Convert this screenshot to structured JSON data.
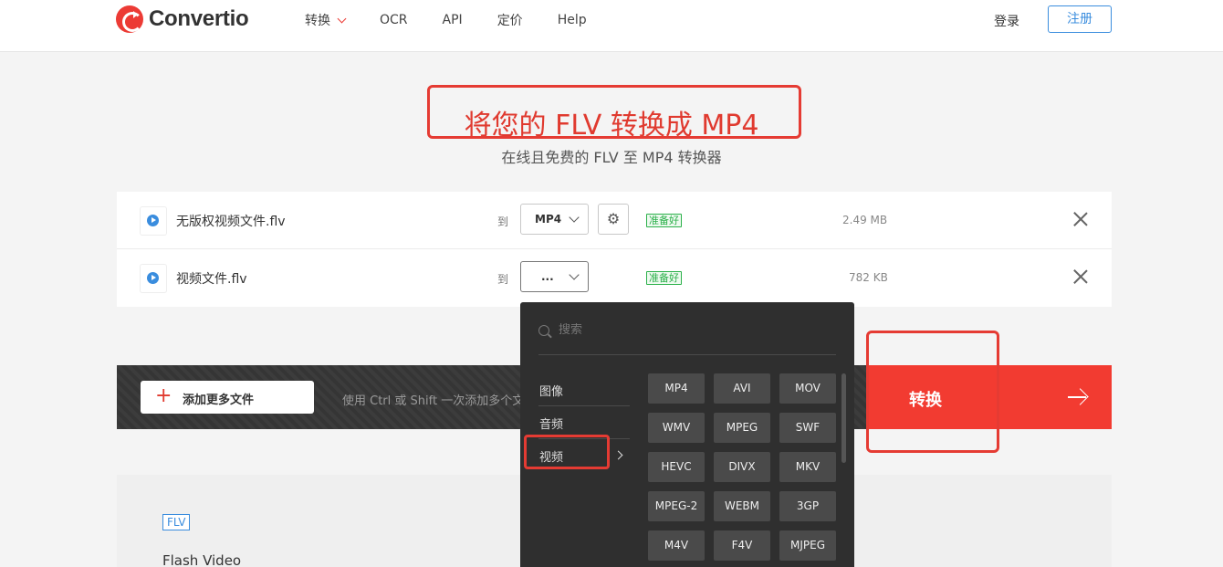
{
  "header": {
    "logo_text": "Convertio",
    "nav": [
      "转换",
      "OCR",
      "API",
      "定价",
      "Help"
    ],
    "login": "登录",
    "signup": "注册"
  },
  "hero": {
    "title": "将您的 FLV 转换成 MP4",
    "subtitle": "在线且免费的 FLV 至 MP4 转换器"
  },
  "files": [
    {
      "name": "无版权视频文件.flv",
      "to_label": "到",
      "format": "MP4",
      "status": "准备好",
      "size": "2.49 MB"
    },
    {
      "name": "视频文件.flv",
      "to_label": "到",
      "format": "...",
      "status": "准备好",
      "size": "782 KB"
    }
  ],
  "actions": {
    "add_more": "添加更多文件",
    "hint": "使用 Ctrl 或 Shift 一次添加多个文件",
    "convert": "转换"
  },
  "info": {
    "tag": "FLV",
    "desc": "Flash Video"
  },
  "dropdown": {
    "search_placeholder": "搜索",
    "categories": [
      "图像",
      "音频",
      "视频"
    ],
    "active_category": "视频",
    "formats": [
      "MP4",
      "AVI",
      "MOV",
      "WMV",
      "MPEG",
      "SWF",
      "HEVC",
      "DIVX",
      "MKV",
      "MPEG-2",
      "WEBM",
      "3GP",
      "M4V",
      "F4V",
      "MJPEG"
    ]
  },
  "colors": {
    "brand_red": "#f23b31",
    "link_blue": "#3a8dde",
    "ready_green": "#2bb04a",
    "dropdown_bg": "#2f2f2f"
  }
}
